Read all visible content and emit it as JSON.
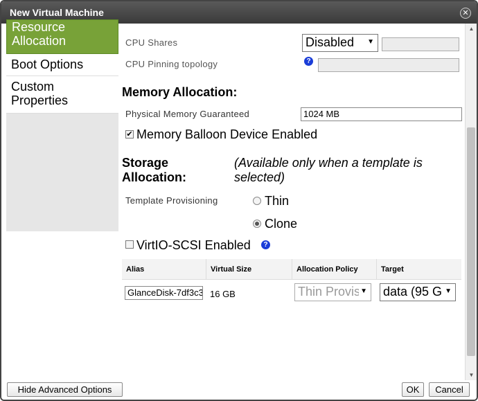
{
  "window": {
    "title": "New Virtual Machine"
  },
  "sidebar": {
    "items": [
      {
        "line1": "Resource",
        "line2": "Allocation"
      },
      {
        "line1": "Boot Options"
      },
      {
        "line1": "Custom",
        "line2": "Properties"
      }
    ]
  },
  "cpu": {
    "shares_label": "CPU Shares",
    "shares_value": "Disabled",
    "pinning_label": "CPU Pinning topology"
  },
  "memory": {
    "heading": "Memory Allocation:",
    "guaranteed_label": "Physical Memory Guaranteed",
    "guaranteed_value": "1024 MB",
    "balloon_label": "Memory Balloon Device Enabled"
  },
  "storage": {
    "heading_line1": "Storage",
    "heading_line2": "Allocation:",
    "note_line1": "(Available only when a template is",
    "note_line2": "selected)",
    "provisioning_label": "Template Provisioning",
    "option_thin": "Thin",
    "option_clone": "Clone",
    "virtio_label": "VirtIO-SCSI Enabled"
  },
  "disk_table": {
    "headers": [
      "Alias",
      "Virtual Size",
      "Allocation Policy",
      "Target"
    ],
    "rows": [
      {
        "alias": "GlanceDisk-7df3c3",
        "size": "16 GB",
        "policy": "Thin Provis",
        "target": "data (95 G"
      }
    ]
  },
  "footer": {
    "advanced_label": "Hide Advanced Options",
    "ok_label": "OK",
    "cancel_label": "Cancel"
  },
  "icons": {
    "close": "close-icon",
    "help": "help-icon",
    "dropdown": "chevron-down-icon"
  },
  "colors": {
    "active_sidebar": "#78a238",
    "help_icon": "#1a3dd8"
  }
}
